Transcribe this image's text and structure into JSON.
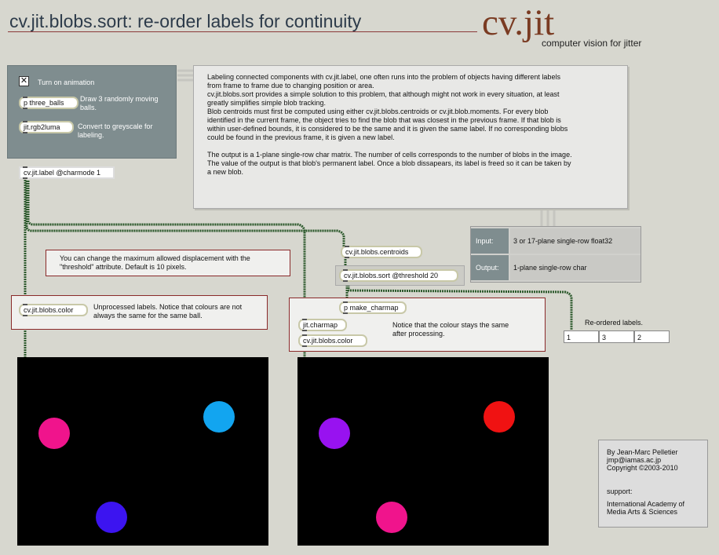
{
  "header": {
    "title": "cv.jit.blobs.sort: re-order labels for continuity",
    "logo": "cv.jit",
    "logo_sub": "computer vision for jitter"
  },
  "control_panel": {
    "toggle_label": "Turn on animation",
    "toggle_checked": true,
    "obj_balls": "p three_balls",
    "obj_balls_desc": "Draw 3 randomly moving balls.",
    "obj_luma": "jit.rgb2luma",
    "obj_luma_desc": "Convert to greyscale for labeling."
  },
  "description": {
    "p1": "Labeling connected components with cv.jit.label, one often runs into the problem of objects having different labels from frame to frame due to changing position or area.",
    "p2": "cv.jit.blobs.sort provides a simple solution to this problem, that although might not work in every situation, at least greatly simplifies simple blob tracking.",
    "p3": "Blob centroids must first be computed using either cv.jit.blobs.centroids or cv.jit.blob.moments. For every blob identified in the current frame, the object tries to find the blob that was closest in the previous frame. If that blob is within user-defined bounds, it is considered to be the same and it is given the same label. If no corresponding blobs could be found in the previous frame, it is given a new label.",
    "p4": "The output is a 1-plane single-row char matrix. The number of cells corresponds to the number of blobs in the image. The value of the output is that blob's permanent label. Once a blob dissapears, its label is freed so it can be taken by a new blob."
  },
  "io": {
    "input_label": "Input:",
    "input_value": "3 or 17-plane single-row float32",
    "output_label": "Output:",
    "output_value": "1-plane single-row char"
  },
  "patch": {
    "label_obj": "cv.jit.label @charmode 1",
    "threshold_note": "You can change the maximum allowed displacement with the \"threshold\" attribute. Default is 10 pixels.",
    "color_obj_left": "cv.jit.blobs.color",
    "unprocessed_note": "Unprocessed labels. Notice that colours are not always the same for the same ball.",
    "centroids_obj": "cv.jit.blobs.centroids",
    "sort_obj": "cv.jit.blobs.sort @threshold 20",
    "charmap_p_obj": "p make_charmap",
    "charmap_obj": "jit.charmap",
    "color_obj_right": "cv.jit.blobs.color",
    "processed_note": "Notice that the colour stays the same after processing.",
    "reordered_label": "Re-ordered labels.",
    "reordered_values": [
      "1",
      "3",
      "2"
    ]
  },
  "screens": {
    "left_balls": [
      {
        "color": "#f0148c"
      },
      {
        "color": "#12a5f0"
      },
      {
        "color": "#3c14f0"
      }
    ],
    "right_balls": [
      {
        "color": "#9812f0"
      },
      {
        "color": "#f01212"
      },
      {
        "color": "#f0148c"
      }
    ]
  },
  "credits": {
    "line1": "By Jean-Marc Pelletier",
    "line2": "jmp@iamas.ac.jp",
    "line3": "Copyright ©2003-2010",
    "support": "support:",
    "org1": "International Academy of",
    "org2": "Media Arts & Sciences"
  }
}
